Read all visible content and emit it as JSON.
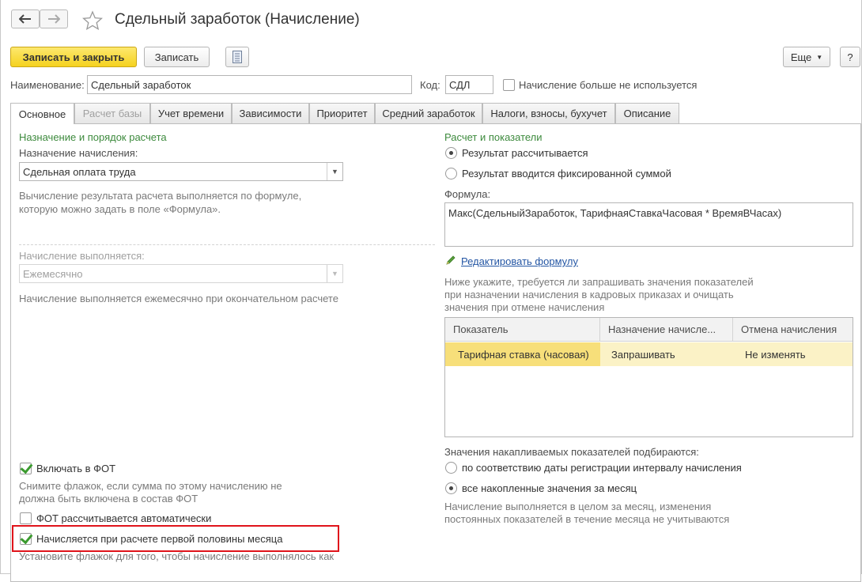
{
  "window": {
    "title": "Сдельный заработок (Начисление)",
    "back_icon": "arrow-left-icon",
    "forward_icon": "arrow-right-icon",
    "favorite_icon": "star-icon"
  },
  "toolbar": {
    "save_close_label": "Записать и закрыть",
    "save_label": "Записать",
    "more_label": "Еще",
    "help_label": "?",
    "report_icon": "document-list-icon"
  },
  "header": {
    "name_label": "Наименование:",
    "name_value": "Сдельный заработок",
    "code_label": "Код:",
    "code_value": "СДЛ",
    "not_used_label": "Начисление больше не используется",
    "not_used_checked": false
  },
  "tabs": [
    {
      "label": "Основное",
      "active": true,
      "disabled": false
    },
    {
      "label": "Расчет базы",
      "active": false,
      "disabled": true
    },
    {
      "label": "Учет времени",
      "active": false,
      "disabled": false
    },
    {
      "label": "Зависимости",
      "active": false,
      "disabled": false
    },
    {
      "label": "Приоритет",
      "active": false,
      "disabled": false
    },
    {
      "label": "Средний заработок",
      "active": false,
      "disabled": false
    },
    {
      "label": "Налоги, взносы, бухучет",
      "active": false,
      "disabled": false
    },
    {
      "label": "Описание",
      "active": false,
      "disabled": false
    }
  ],
  "left": {
    "section_title": "Назначение и порядок расчета",
    "purpose_label": "Назначение начисления:",
    "purpose_value": "Сдельная оплата труда",
    "purpose_hint_1": "Вычисление результата расчета выполняется по формуле,",
    "purpose_hint_2": "которую можно задать в поле «Формула».",
    "period_label": "Начисление выполняется:",
    "period_value": "Ежемесячно",
    "period_hint": "Начисление выполняется ежемесячно при окончательном расчете",
    "fot_label": "Включать в ФОТ",
    "fot_checked": true,
    "fot_hint_1": "Снимите флажок, если сумма по этому начислению не",
    "fot_hint_2": "должна быть включена в состав ФОТ",
    "fot_auto_label": "ФОТ рассчитывается автоматически",
    "fot_auto_checked": false,
    "first_half_label": "Начисляется при расчете первой половины месяца",
    "first_half_checked": true,
    "first_half_hint": "Установите флажок для того, чтобы начисление выполнялось как"
  },
  "right": {
    "section_title": "Расчет и показатели",
    "radio_calculated": "Результат рассчитывается",
    "radio_fixed": "Результат вводится фиксированной суммой",
    "formula_label": "Формула:",
    "formula_value": "Макс(СдельныйЗаработок, ТарифнаяСтавкаЧасовая * ВремяВЧасах)",
    "edit_formula_link": "Редактировать формулу",
    "edit_icon": "pencil-icon",
    "indicators_hint_1": "Ниже укажите, требуется ли запрашивать значения показателей",
    "indicators_hint_2": "при назначении начисления в кадровых приказах и очищать",
    "indicators_hint_3": "значения при отмене начисления",
    "table": {
      "columns": [
        "Показатель",
        "Назначение начисле...",
        "Отмена начисления"
      ],
      "rows": [
        [
          "Тарифная ставка (часовая)",
          "Запрашивать",
          "Не изменять"
        ]
      ]
    },
    "accum_title": "Значения накапливаемых показателей подбираются:",
    "accum_option_1": "по соответствию даты регистрации интервалу начисления",
    "accum_option_2": "все накопленные значения за месяц",
    "accum_hint_1": "Начисление выполняется в целом за месяц, изменения",
    "accum_hint_2": "постоянных показателей в течение месяца не учитываются"
  },
  "colors": {
    "primary_button": "#f5d21f",
    "section_title": "#3d8a3d",
    "link": "#2456a4",
    "selected_row": "#fbf2c6",
    "highlight_border": "#e0141b"
  }
}
